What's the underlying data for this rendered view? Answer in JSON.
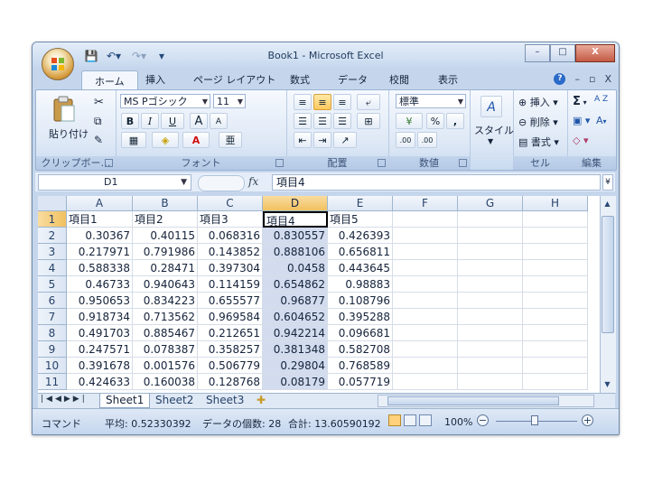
{
  "window": {
    "title": "Book1 - Microsoft Excel",
    "buttons": {
      "minimize": "–",
      "restore": "□",
      "close": "X"
    }
  },
  "qat": {
    "save": "💾",
    "undo": "↶▾",
    "redo": "↷▾",
    "more": "▾"
  },
  "tabs": [
    "ホーム",
    "挿入",
    "ページ レイアウト",
    "数式",
    "データ",
    "校閲",
    "表示"
  ],
  "mdi": {
    "help": "?",
    "min": "–",
    "restore": "▫",
    "close": "X"
  },
  "ribbon": {
    "clipboard": {
      "label": "クリップボー…",
      "paste": "貼り付け"
    },
    "font": {
      "label": "フォント",
      "name": "MS Pゴシック",
      "size": "11",
      "bold": "B",
      "italic": "I",
      "underline": "U",
      "grow": "A",
      "shrink": "A",
      "color_a": "A",
      "phonetic": "亜"
    },
    "alignment": {
      "label": "配置"
    },
    "number": {
      "label": "数値",
      "format": "標準",
      "percent": "%",
      "comma": ",",
      "inc": ".00",
      "dec": ".00"
    },
    "styles": {
      "label": "スタイル"
    },
    "cells": {
      "label": "セル",
      "insert": "挿入",
      "delete": "削除",
      "format": "書式"
    },
    "editing": {
      "label": "編集",
      "sum": "Σ",
      "sort": "A Z",
      "find": "A"
    }
  },
  "formula_bar": {
    "name_box": "D1",
    "fx": "fx",
    "value": "項目4"
  },
  "columns": [
    "A",
    "B",
    "C",
    "D",
    "E",
    "F",
    "G",
    "H"
  ],
  "rows": [
    "1",
    "2",
    "3",
    "4",
    "5",
    "6",
    "7",
    "8",
    "9",
    "10",
    "11"
  ],
  "cells": [
    [
      "項目1",
      "項目2",
      "項目3",
      "項目4",
      "項目5"
    ],
    [
      "0.30367",
      "0.40115",
      "0.068316",
      "0.830557",
      "0.426393"
    ],
    [
      "0.217971",
      "0.791986",
      "0.143852",
      "0.888106",
      "0.656811"
    ],
    [
      "0.588338",
      "0.28471",
      "0.397304",
      "0.0458",
      "0.443645"
    ],
    [
      "0.46733",
      "0.940643",
      "0.114159",
      "0.654862",
      "0.98883"
    ],
    [
      "0.950653",
      "0.834223",
      "0.655577",
      "0.96877",
      "0.108796"
    ],
    [
      "0.918734",
      "0.713562",
      "0.969584",
      "0.604652",
      "0.395288"
    ],
    [
      "0.491703",
      "0.885467",
      "0.212651",
      "0.942214",
      "0.096681"
    ],
    [
      "0.247571",
      "0.078387",
      "0.358257",
      "0.381348",
      "0.582708"
    ],
    [
      "0.391678",
      "0.001576",
      "0.506779",
      "0.29804",
      "0.768589"
    ],
    [
      "0.424633",
      "0.160038",
      "0.128768",
      "0.08179",
      "0.057719"
    ]
  ],
  "sheets": [
    "Sheet1",
    "Sheet2",
    "Sheet3"
  ],
  "status": {
    "mode": "コマンド",
    "average": "平均: 0.52330392",
    "count": "データの個数: 28",
    "sum": "合計: 13.60590192",
    "zoom": "100%"
  }
}
